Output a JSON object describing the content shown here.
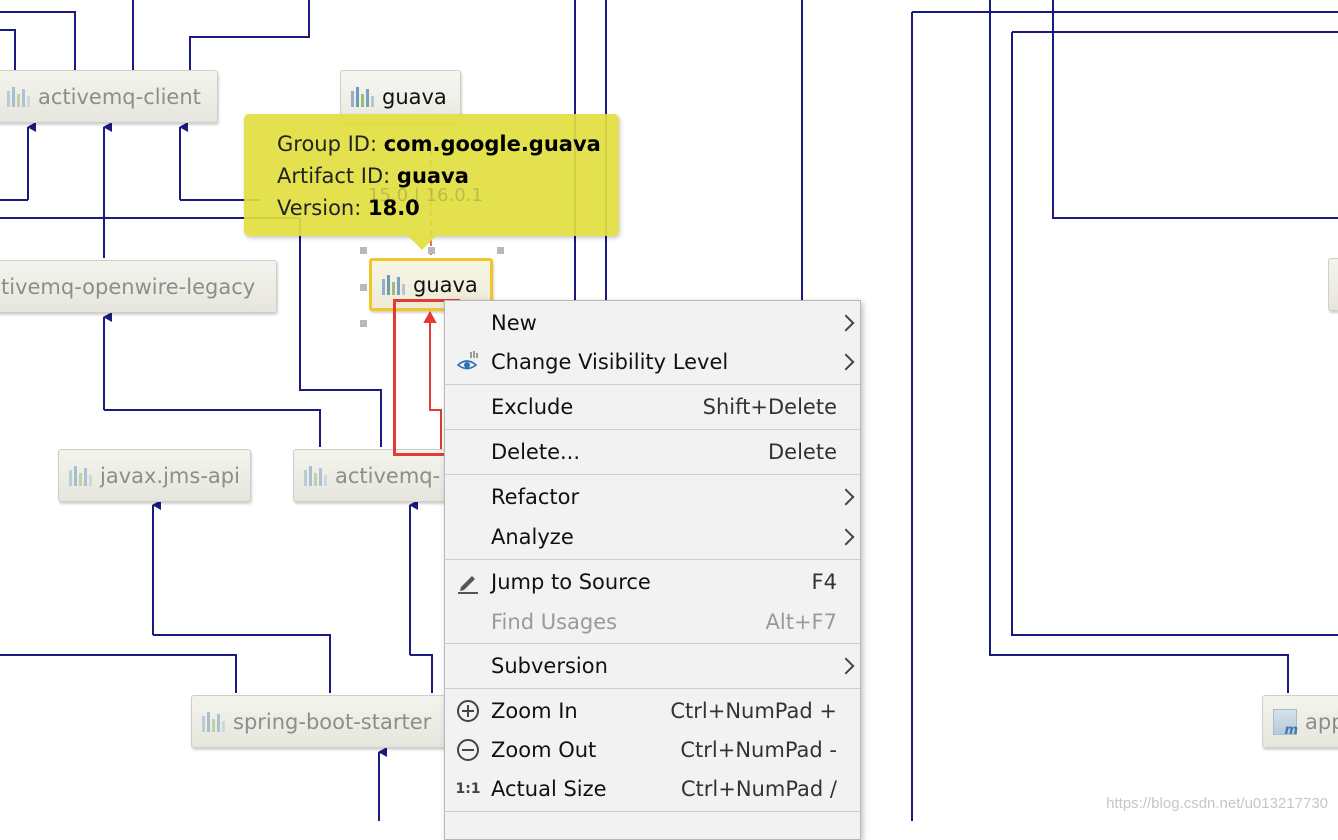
{
  "diagram": {
    "nodes": {
      "activemq_client": "activemq-client",
      "guava_top": "guava",
      "openwire_legacy": "tivemq-openwire-legacy",
      "guava_selected": "guava",
      "javax_jms_api": "javax.jms-api",
      "activemq_partial": "activemq-",
      "spring_boot_starter": "spring-boot-starter",
      "app_partial": "app"
    },
    "ghost_label": "15.0 | 16.0.1"
  },
  "tooltip": {
    "group_label": "Group ID: ",
    "group_value": "com.google.guava",
    "artifact_label": "Artifact ID: ",
    "artifact_value": "guava",
    "version_label": "Version: ",
    "version_value": "18.0"
  },
  "menu": {
    "items": [
      {
        "label": "New",
        "shortcut": "",
        "submenu": true
      },
      {
        "label": "Change Visibility Level",
        "shortcut": "",
        "submenu": true,
        "icon": "eye-visibility-icon"
      },
      {
        "label": "Exclude",
        "shortcut": "Shift+Delete"
      },
      {
        "label": "Delete...",
        "shortcut": "Delete"
      },
      {
        "label": "Refactor",
        "shortcut": "",
        "submenu": true
      },
      {
        "label": "Analyze",
        "shortcut": "",
        "submenu": true
      },
      {
        "label": "Jump to Source",
        "shortcut": "F4",
        "icon": "pencil-icon"
      },
      {
        "label": "Find Usages",
        "shortcut": "Alt+F7",
        "disabled": true
      },
      {
        "label": "Subversion",
        "shortcut": "",
        "submenu": true
      },
      {
        "label": "Zoom In",
        "shortcut": "Ctrl+NumPad +",
        "icon": "zoom-in-icon"
      },
      {
        "label": "Zoom Out",
        "shortcut": "Ctrl+NumPad -",
        "icon": "zoom-out-icon"
      },
      {
        "label": "Actual Size",
        "shortcut": "Ctrl+NumPad /",
        "icon": "actual-size-icon",
        "icon_text": "1:1"
      }
    ]
  },
  "colors": {
    "edge": "#1a1a80",
    "edge_gray": "#7a7a99",
    "highlight_red": "#e53935",
    "selection_yellow": "#f2c62b",
    "tooltip_bg": "#e1de3e"
  },
  "watermark": "https://blog.csdn.net/u013217730"
}
